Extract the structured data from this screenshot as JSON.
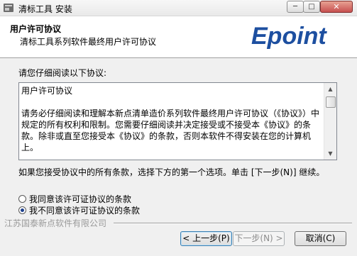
{
  "window": {
    "title": "清标工具 安装",
    "minimize_glyph": "─",
    "maximize_glyph": "□",
    "close_glyph": "✕"
  },
  "header": {
    "title": "用户许可协议",
    "subtitle": "清标工具系列软件最终用户许可协议",
    "logo_text": "Epoint",
    "logo_color": "#1d4fa0"
  },
  "prompt": "请您仔细阅读以下协议:",
  "eula": {
    "text": "用户许可协议\n\n请务必仔细阅读和理解本新点清单造价系列软件最终用户许可协议（《协议》）中规定的所有权利和限制。您需要仔细阅读并决定接受或不接受本《协议》的条款。除非或直至您接受本《协议》的条款，否则本软件不得安装在您的计算机上。"
  },
  "accept_note": "如果您接受协议中的所有条款，选择下方的第一个选项。单击 [下一步(N)] 继续。",
  "options": [
    {
      "label": "我同意该许可证协议的条款",
      "checked": false
    },
    {
      "label": "我不同意该许可证协议的条款",
      "checked": true
    }
  ],
  "company": "江苏国泰新点软件有限公司",
  "buttons": {
    "back": "< 上一步(P)",
    "next": "下一步(N) >",
    "cancel": "取消(C)"
  }
}
